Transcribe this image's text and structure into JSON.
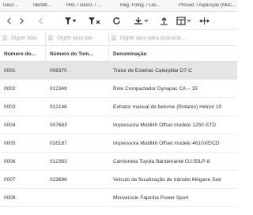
{
  "tabs": [
    "Desc...",
    "Identifi...",
    "Hist. / Descr. / ...",
    "Reg. Fotog. / Loc...",
    "Proced. / Aquisição (MuC..."
  ],
  "toolbar": {
    "icons": [
      "back-icon",
      "forward-icon",
      "add-filter-icon",
      "remove-filter-icon",
      "refresh-icon",
      "export-icon",
      "upload-icon",
      "columns-icon",
      "expand-columns-icon"
    ]
  },
  "filters": {
    "placeholders": [
      "Digite aqui",
      "Digite aqui par",
      "Digite aqui para procurar..."
    ]
  },
  "table": {
    "columns": [
      "Número do...",
      "Número do Tom...",
      "Denominação"
    ],
    "rows": [
      {
        "num": "0001",
        "tombo": "008370",
        "denominacao": "Trator de Esteiras Caterpillar D7-C",
        "selected": true
      },
      {
        "num": "0002",
        "tombo": "012348",
        "denominacao": "Rolo Compactador Dynapac CA – 15",
        "selected": false
      },
      {
        "num": "0003",
        "tombo": "012146",
        "denominacao": "Extrator manual de betume (Rotarex) Helnor 10",
        "selected": false
      },
      {
        "num": "0004",
        "tombo": "007683",
        "denominacao": "Impressora Multilith Offset modelo 1250-STD",
        "selected": false
      },
      {
        "num": "0005",
        "tombo": "016187",
        "denominacao": "Impressora Multilith Offset modelo 4610XE/CD",
        "selected": false
      },
      {
        "num": "0006",
        "tombo": "012363",
        "denominacao": "Camioneta Toyota Bandeirante OJ-55LP-8",
        "selected": false
      },
      {
        "num": "0007",
        "tombo": "023696",
        "denominacao": "Veículo de fiscalização de trânsito Mégane Sed",
        "selected": false
      },
      {
        "num": "0008",
        "tombo": "",
        "denominacao": "Miniveículo Fapinha Power Sport",
        "selected": false
      }
    ]
  }
}
